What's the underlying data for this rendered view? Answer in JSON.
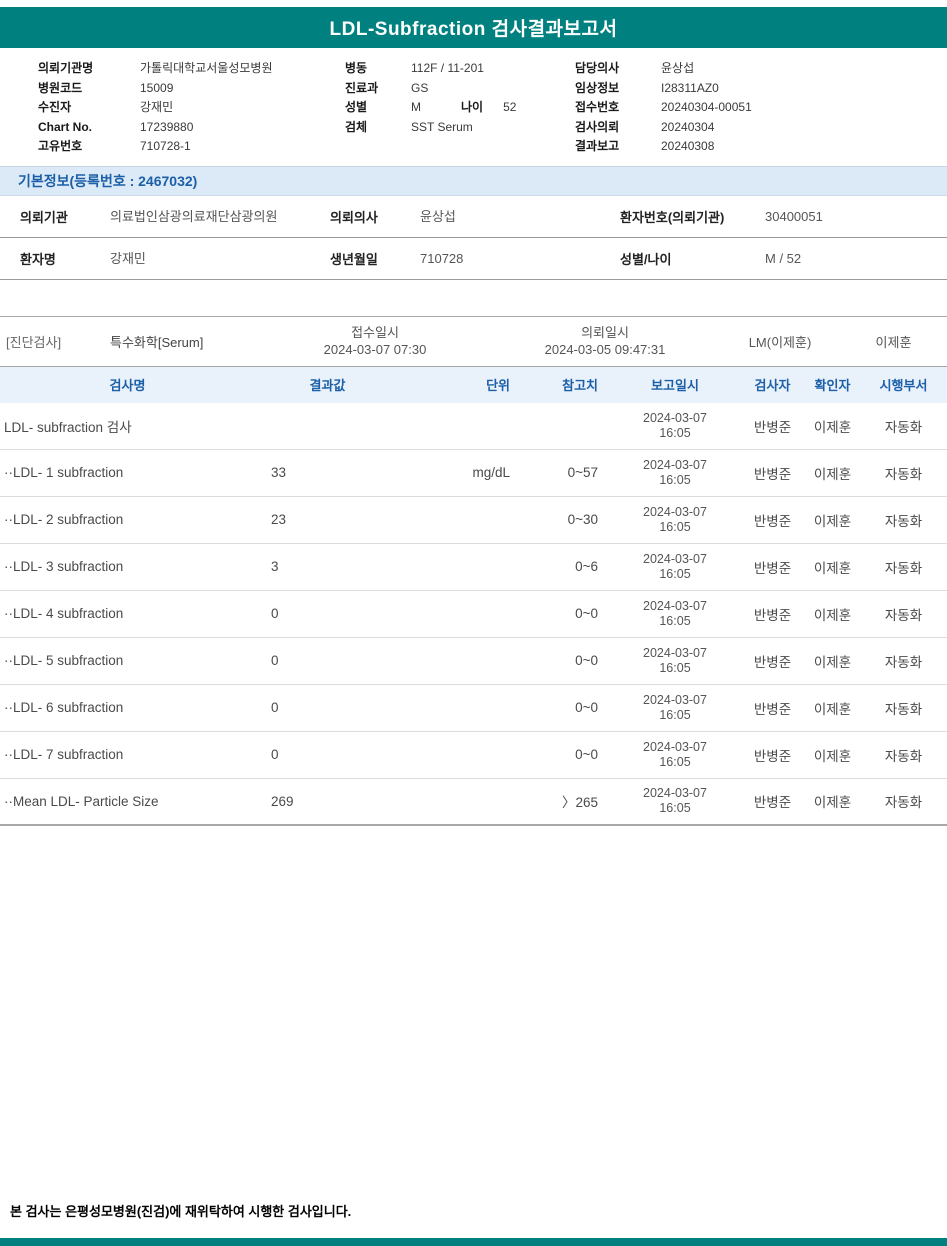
{
  "report": {
    "title": "LDL-Subfraction 검사결과보고서",
    "footer_note": "본 검사는 은평성모병원(진검)에 재위탁하여 시행한 검사입니다."
  },
  "header_info": {
    "left": [
      {
        "label": "의뢰기관명",
        "value": "가톨릭대학교서울성모병원"
      },
      {
        "label": "병원코드",
        "value": "15009"
      },
      {
        "label": "수진자",
        "value": "강재민"
      },
      {
        "label": "Chart No.",
        "value": "17239880"
      },
      {
        "label": "고유번호",
        "value": "710728-1"
      }
    ],
    "middle": [
      {
        "label": "병동",
        "value": "112F / 11-201"
      },
      {
        "label": "진료과",
        "value": "GS"
      },
      {
        "label": "성별",
        "value": "M",
        "label2": "나이",
        "value2": "52"
      },
      {
        "label": "검체",
        "value": "SST Serum"
      }
    ],
    "right": [
      {
        "label": "담당의사",
        "value": "윤상섭"
      },
      {
        "label": "임상정보",
        "value": "I28311AZ0"
      },
      {
        "label": "접수번호",
        "value": "20240304-00051"
      },
      {
        "label": "검사의뢰",
        "value": "20240304"
      },
      {
        "label": "결과보고",
        "value": "20240308"
      }
    ]
  },
  "basic_info": {
    "section_title": "기본정보(등록번호 : 2467032)",
    "rows": [
      {
        "pairs": [
          {
            "label": "의뢰기관",
            "value": "의료법인삼광의료재단삼광의원"
          },
          {
            "label": "의뢰의사",
            "value": "윤상섭"
          },
          {
            "label": "환자번호(의뢰기관)",
            "value": "30400051"
          }
        ]
      },
      {
        "pairs": [
          {
            "label": "환자명",
            "value": "강재민"
          },
          {
            "label": "생년월일",
            "value": "710728"
          },
          {
            "label": "성별/나이",
            "value": "M / 52"
          }
        ]
      }
    ]
  },
  "exam_section": {
    "category": "[진단검사]",
    "test_type": "특수화학[Serum]",
    "receipt_label": "접수일시",
    "receipt_datetime": "2024-03-07 07:30",
    "request_label": "의뢰일시",
    "request_datetime": "2024-03-05 09:47:31",
    "lab": "LM(이제훈)",
    "reader": "이제훈"
  },
  "results_table": {
    "columns": [
      "검사명",
      "결과값",
      "단위",
      "참고치",
      "보고일시",
      "검사자",
      "확인자",
      "시행부서"
    ],
    "rows": [
      {
        "name": "LDL- subfraction 검사",
        "result": "",
        "unit": "",
        "ref": "",
        "report_date": "2024-03-07",
        "report_time": "16:05",
        "tester": "반병준",
        "confirmer": "이제훈",
        "dept": "자동화"
      },
      {
        "name": "··LDL- 1 subfraction",
        "result": "33",
        "unit": "mg/dL",
        "ref": "0~57",
        "report_date": "2024-03-07",
        "report_time": "16:05",
        "tester": "반병준",
        "confirmer": "이제훈",
        "dept": "자동화"
      },
      {
        "name": "··LDL- 2 subfraction",
        "result": "23",
        "unit": "",
        "ref": "0~30",
        "report_date": "2024-03-07",
        "report_time": "16:05",
        "tester": "반병준",
        "confirmer": "이제훈",
        "dept": "자동화"
      },
      {
        "name": "··LDL- 3 subfraction",
        "result": "3",
        "unit": "",
        "ref": "0~6",
        "report_date": "2024-03-07",
        "report_time": "16:05",
        "tester": "반병준",
        "confirmer": "이제훈",
        "dept": "자동화"
      },
      {
        "name": "··LDL- 4 subfraction",
        "result": "0",
        "unit": "",
        "ref": "0~0",
        "report_date": "2024-03-07",
        "report_time": "16:05",
        "tester": "반병준",
        "confirmer": "이제훈",
        "dept": "자동화"
      },
      {
        "name": "··LDL- 5 subfraction",
        "result": "0",
        "unit": "",
        "ref": "0~0",
        "report_date": "2024-03-07",
        "report_time": "16:05",
        "tester": "반병준",
        "confirmer": "이제훈",
        "dept": "자동화"
      },
      {
        "name": "··LDL- 6 subfraction",
        "result": "0",
        "unit": "",
        "ref": "0~0",
        "report_date": "2024-03-07",
        "report_time": "16:05",
        "tester": "반병준",
        "confirmer": "이제훈",
        "dept": "자동화"
      },
      {
        "name": "··LDL- 7 subfraction",
        "result": "0",
        "unit": "",
        "ref": "0~0",
        "report_date": "2024-03-07",
        "report_time": "16:05",
        "tester": "반병준",
        "confirmer": "이제훈",
        "dept": "자동화"
      },
      {
        "name": "··Mean LDL- Particle Size",
        "result": "269",
        "unit": "",
        "ref": "〉265",
        "report_date": "2024-03-07",
        "report_time": "16:05",
        "tester": "반병준",
        "confirmer": "이제훈",
        "dept": "자동화"
      }
    ]
  },
  "colors": {
    "header_teal": "#008180",
    "accent_blue_text": "#1b5fa8",
    "section_bar_bg": "#dce9f6",
    "table_header_bg": "#e9f1fb"
  }
}
